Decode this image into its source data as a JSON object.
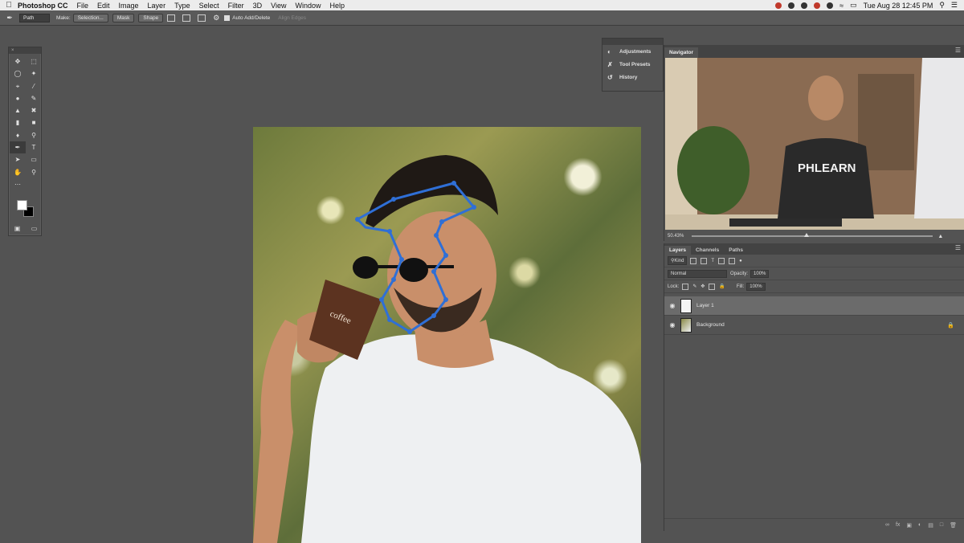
{
  "menubar": {
    "app_name": "Photoshop CC",
    "items": [
      "File",
      "Edit",
      "Image",
      "Layer",
      "Type",
      "Select",
      "Filter",
      "3D",
      "View",
      "Window",
      "Help"
    ],
    "clock": "Tue Aug 28  12:45 PM"
  },
  "options": {
    "mode": "Path",
    "make_label": "Make:",
    "selection_btn": "Selection...",
    "mask_btn": "Mask",
    "shape_btn": "Shape",
    "auto_add_delete": "Auto Add/Delete",
    "align_edges": "Align Edges"
  },
  "mini_panel": {
    "items": [
      "Adjustments",
      "Tool Presets",
      "History"
    ]
  },
  "navigator": {
    "tab": "Navigator",
    "zoom": "50.43%",
    "preview_text": "PHLEARN"
  },
  "layers": {
    "tabs": [
      "Layers",
      "Channels",
      "Paths"
    ],
    "kind": "Kind",
    "blend_mode": "Normal",
    "opacity_label": "Opacity:",
    "opacity": "100%",
    "lock_label": "Lock:",
    "fill_label": "Fill:",
    "fill": "100%",
    "items": [
      {
        "name": "Layer 1"
      },
      {
        "name": "Background"
      }
    ]
  },
  "colors": {
    "path_stroke": "#2f6fd6"
  }
}
